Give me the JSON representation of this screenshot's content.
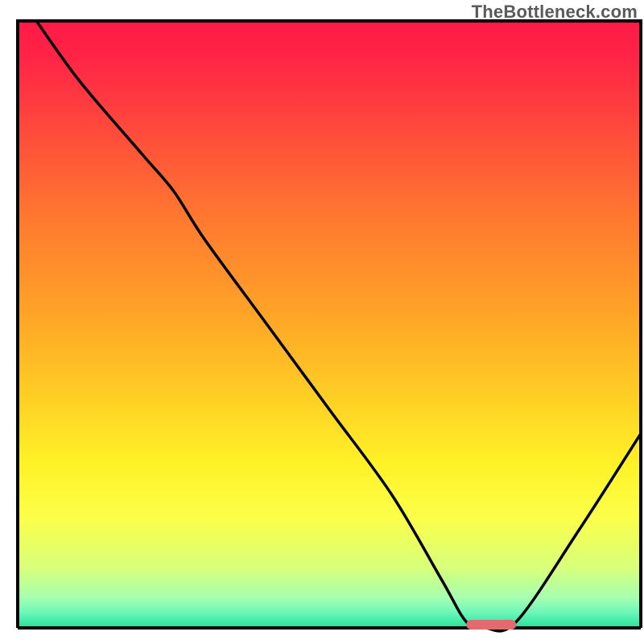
{
  "watermark": "TheBottleneck.com",
  "chart_data": {
    "type": "line",
    "title": "",
    "xlabel": "",
    "ylabel": "",
    "xlim": [
      0,
      100
    ],
    "ylim": [
      0,
      100
    ],
    "grid": false,
    "legend": false,
    "series": [
      {
        "name": "bottleneck-curve",
        "x": [
          3,
          10,
          20,
          25,
          30,
          40,
          50,
          60,
          68,
          72,
          75,
          80,
          90,
          100
        ],
        "values": [
          100,
          90,
          78,
          72,
          64,
          50,
          36,
          22,
          8,
          1,
          0,
          1,
          16,
          32
        ]
      }
    ],
    "marker": {
      "name": "optimal-zone",
      "x_start": 72,
      "x_end": 80,
      "y": 0,
      "color": "#e16b6f"
    },
    "gradient_stops": [
      {
        "offset": 0.0,
        "color": "#ff1a47"
      },
      {
        "offset": 0.06,
        "color": "#ff2446"
      },
      {
        "offset": 0.18,
        "color": "#ff4a3c"
      },
      {
        "offset": 0.33,
        "color": "#ff7a2f"
      },
      {
        "offset": 0.48,
        "color": "#ffa327"
      },
      {
        "offset": 0.62,
        "color": "#ffcf24"
      },
      {
        "offset": 0.73,
        "color": "#fff227"
      },
      {
        "offset": 0.82,
        "color": "#fbff4a"
      },
      {
        "offset": 0.9,
        "color": "#d8ff7a"
      },
      {
        "offset": 0.95,
        "color": "#a6ffb0"
      },
      {
        "offset": 0.975,
        "color": "#6cf7b9"
      },
      {
        "offset": 1.0,
        "color": "#24e09a"
      }
    ],
    "frame_color": "#000000",
    "curve_color": "#000000",
    "axis_baseline_color": "#000000"
  }
}
